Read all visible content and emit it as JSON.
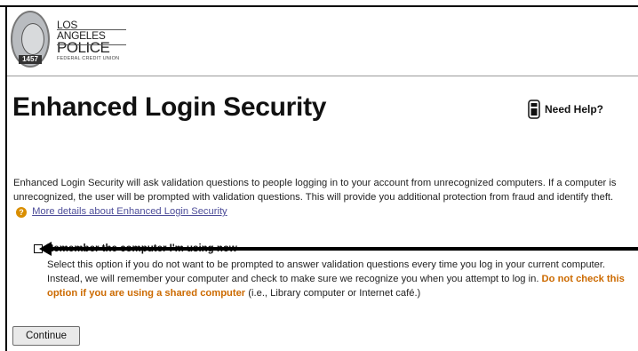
{
  "logo": {
    "seal_number": "1457",
    "line1": "LOS ANGELES",
    "line2": "POLICE",
    "line3": "FEDERAL CREDIT UNION"
  },
  "page": {
    "title": "Enhanced Login Security",
    "help_label": "Need Help?"
  },
  "intro": {
    "text": "Enhanced Login Security will ask validation questions to people logging in to your account from unrecognized computers. If a computer is unrecognized, the user will be prompted with validation questions. This will provide you additional protection from fraud and identify theft.",
    "icon_label": "?",
    "link_text": "More details about Enhanced Login Security"
  },
  "remember": {
    "label": "Remember the computer I'm using now",
    "checked": false,
    "description": "Select this option if you do not want to be prompted to answer validation questions every time you log in your current computer. Instead, we will remember your computer and check to make sure we recognize you when you attempt to log in.",
    "warning": "Do not check this option if you are using a shared computer",
    "note": "(i.e., Library computer or Internet café.)"
  },
  "actions": {
    "continue_label": "Continue"
  },
  "colors": {
    "warning": "#cc6a00",
    "link": "#4d4d99",
    "help_icon": "#d98e00"
  },
  "icons": {
    "help": "phone-icon",
    "info": "question-icon",
    "annotation": "arrow-icon"
  }
}
